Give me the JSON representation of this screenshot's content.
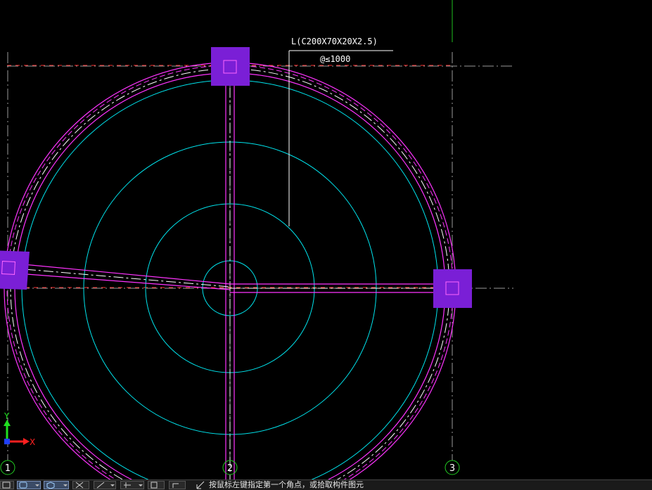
{
  "annotation": {
    "line1": "L(C200X70X20X2.5)",
    "line2": "@≤1000"
  },
  "grid_axes": [
    {
      "label": "1"
    },
    {
      "label": "2"
    },
    {
      "label": "3"
    }
  ],
  "ucs": {
    "x_label": "X",
    "y_label": "Y"
  },
  "status_bar": {
    "prompt": "按鼠标左键指定第一个角点，或拾取构件图元"
  },
  "colors": {
    "background": "#000000",
    "axis_line": "#b0b0b0",
    "axis_dash_red": "#ff3030",
    "arc_magenta": "#ff33ff",
    "arc_white_dash": "#ffffff",
    "circle_cyan": "#00e5ee",
    "column_fill": "#7a1fd6",
    "leader_white": "#ffffff",
    "axis_circle": "#22cc22",
    "ucs_x": "#ff2020",
    "ucs_y": "#20e020"
  },
  "toolbar": {
    "icons": [
      "select-icon",
      "box-select-icon",
      "3d-view-icon",
      "delete-icon",
      "line-draw-icon",
      "align-icon",
      "copy-icon",
      "rotate-icon"
    ]
  }
}
